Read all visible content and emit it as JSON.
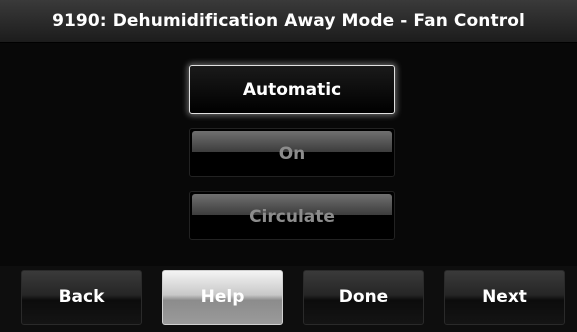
{
  "header": {
    "title": "9190: Dehumidification Away Mode - Fan Control"
  },
  "options": {
    "automatic": "Automatic",
    "on": "On",
    "circulate": "Circulate",
    "selected": "Automatic"
  },
  "nav": {
    "back": "Back",
    "help": "Help",
    "done": "Done",
    "next": "Next"
  },
  "colors": {
    "background": "#080808",
    "text": "#ffffff",
    "disabled_text": "#8c8c8c",
    "help_button": "#c8c8c8"
  }
}
